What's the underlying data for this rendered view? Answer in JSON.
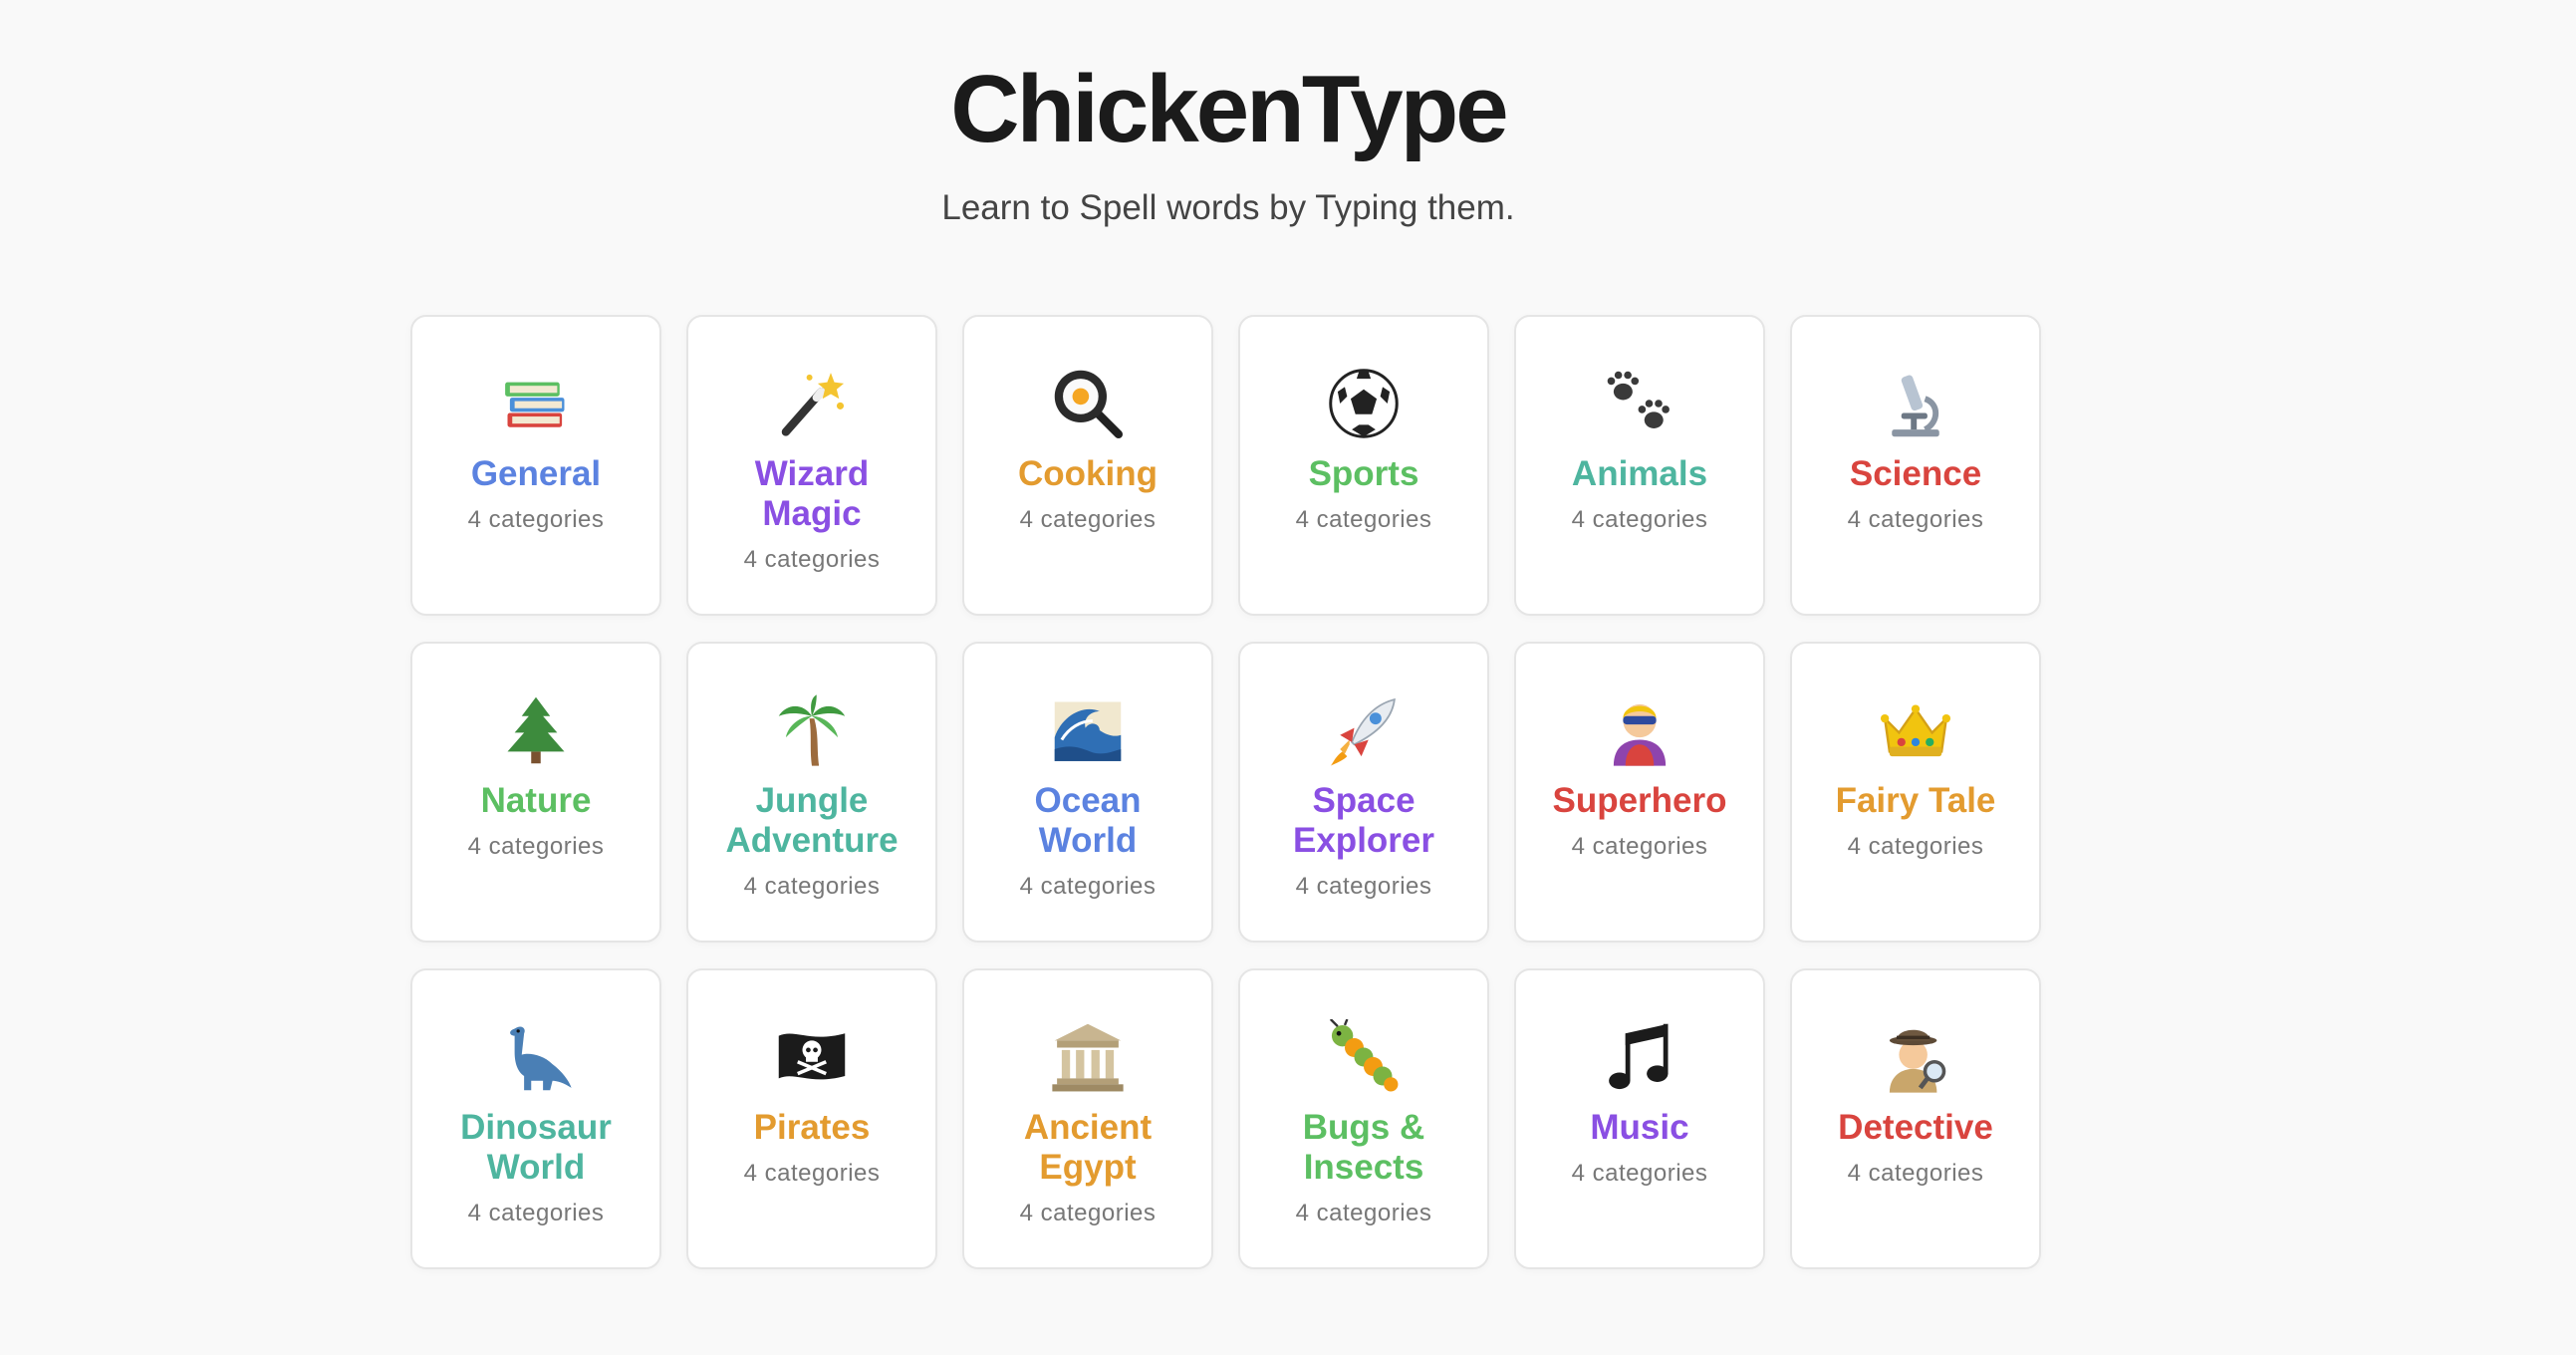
{
  "app": {
    "title": "ChickenType",
    "subtitle": "Learn to Spell words by Typing them."
  },
  "colors": {
    "blue": "#5b82e0",
    "purple": "#8a4fe3",
    "orange": "#e39b2f",
    "green": "#5cbf62",
    "teal": "#4eb59f",
    "red": "#d9443e"
  },
  "cards": [
    {
      "title": "General",
      "count": "4 categories",
      "icon": "books-icon",
      "color": "#5b82e0"
    },
    {
      "title": "Wizard Magic",
      "count": "4 categories",
      "icon": "magic-wand-icon",
      "color": "#8a4fe3"
    },
    {
      "title": "Cooking",
      "count": "4 categories",
      "icon": "frying-pan-icon",
      "color": "#e39b2f"
    },
    {
      "title": "Sports",
      "count": "4 categories",
      "icon": "soccer-ball-icon",
      "color": "#5cbf62"
    },
    {
      "title": "Animals",
      "count": "4 categories",
      "icon": "paw-prints-icon",
      "color": "#4eb59f"
    },
    {
      "title": "Science",
      "count": "4 categories",
      "icon": "microscope-icon",
      "color": "#d9443e"
    },
    {
      "title": "Nature",
      "count": "4 categories",
      "icon": "evergreen-tree-icon",
      "color": "#5cbf62"
    },
    {
      "title": "Jungle Adventure",
      "count": "4 categories",
      "icon": "palm-tree-icon",
      "color": "#4eb59f"
    },
    {
      "title": "Ocean World",
      "count": "4 categories",
      "icon": "wave-icon",
      "color": "#5b82e0"
    },
    {
      "title": "Space Explorer",
      "count": "4 categories",
      "icon": "rocket-icon",
      "color": "#8a4fe3"
    },
    {
      "title": "Superhero",
      "count": "4 categories",
      "icon": "superhero-icon",
      "color": "#d9443e"
    },
    {
      "title": "Fairy Tale",
      "count": "4 categories",
      "icon": "crown-icon",
      "color": "#e39b2f"
    },
    {
      "title": "Dinosaur World",
      "count": "4 categories",
      "icon": "dinosaur-icon",
      "color": "#4eb59f"
    },
    {
      "title": "Pirates",
      "count": "4 categories",
      "icon": "pirate-flag-icon",
      "color": "#e39b2f"
    },
    {
      "title": "Ancient Egypt",
      "count": "4 categories",
      "icon": "classical-building-icon",
      "color": "#e39b2f"
    },
    {
      "title": "Bugs & Insects",
      "count": "4 categories",
      "icon": "bug-icon",
      "color": "#5cbf62"
    },
    {
      "title": "Music",
      "count": "4 categories",
      "icon": "music-note-icon",
      "color": "#8a4fe3"
    },
    {
      "title": "Detective",
      "count": "4 categories",
      "icon": "detective-icon",
      "color": "#d9443e"
    }
  ]
}
